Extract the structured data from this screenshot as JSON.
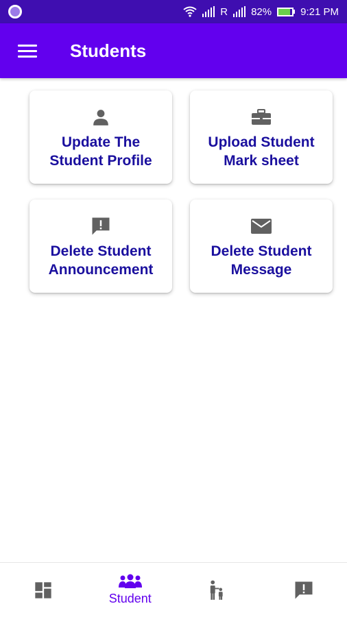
{
  "status_bar": {
    "carrier_letter": "R",
    "battery": "82%",
    "battery_level": 0.82,
    "time": "9:21 PM"
  },
  "app_bar": {
    "title": "Students",
    "menu_icon": "hamburger-menu-icon"
  },
  "cards": [
    {
      "label": "Update The Student Profile",
      "icon": "person-icon"
    },
    {
      "label": "Upload Student Mark sheet",
      "icon": "briefcase-icon"
    },
    {
      "label": "Delete Student Announcement",
      "icon": "announcement-icon"
    },
    {
      "label": "Delete Student Message",
      "icon": "mail-icon"
    }
  ],
  "bottom_nav": {
    "items": [
      {
        "icon": "dashboard-icon",
        "label": ""
      },
      {
        "icon": "group-icon",
        "label": "Student",
        "selected": true
      },
      {
        "icon": "parent-child-icon",
        "label": ""
      },
      {
        "icon": "feedback-icon",
        "label": ""
      }
    ]
  },
  "colors": {
    "status_bar": "#3f0eb0",
    "app_bar": "#6200ee",
    "card_text": "#1a0f9e",
    "icon_gray": "#616161",
    "active": "#6200ee"
  }
}
